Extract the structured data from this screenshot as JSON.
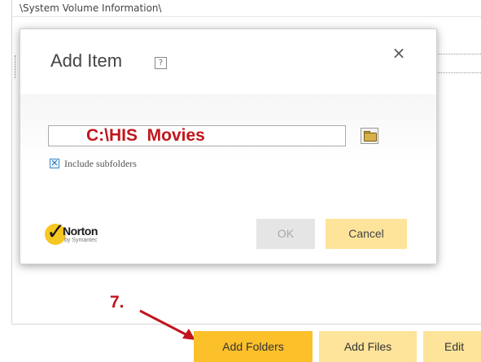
{
  "background": {
    "path_row": "\\System Volume Information\\"
  },
  "dialog": {
    "title": "Add Item",
    "help_glyph": "?",
    "close_glyph": "×",
    "path_value": "C:\\HIS  Movies",
    "include_subfolders_label": "Include subfolders",
    "include_subfolders_checked": true,
    "checkbox_glyph": "✕",
    "ok_label": "OK",
    "cancel_label": "Cancel",
    "logo": {
      "brand": "Norton",
      "sub": "by Symantec",
      "check_glyph": "✓"
    }
  },
  "annotation": {
    "step": "7."
  },
  "buttons": {
    "add_folders": "Add Folders",
    "add_files": "Add Files",
    "edit": "Edit"
  },
  "colors": {
    "accent_primary": "#fcc02a",
    "accent_secondary": "#fde49a",
    "annotation_red": "#c0161c",
    "disabled_button": "#e5e5e5"
  }
}
